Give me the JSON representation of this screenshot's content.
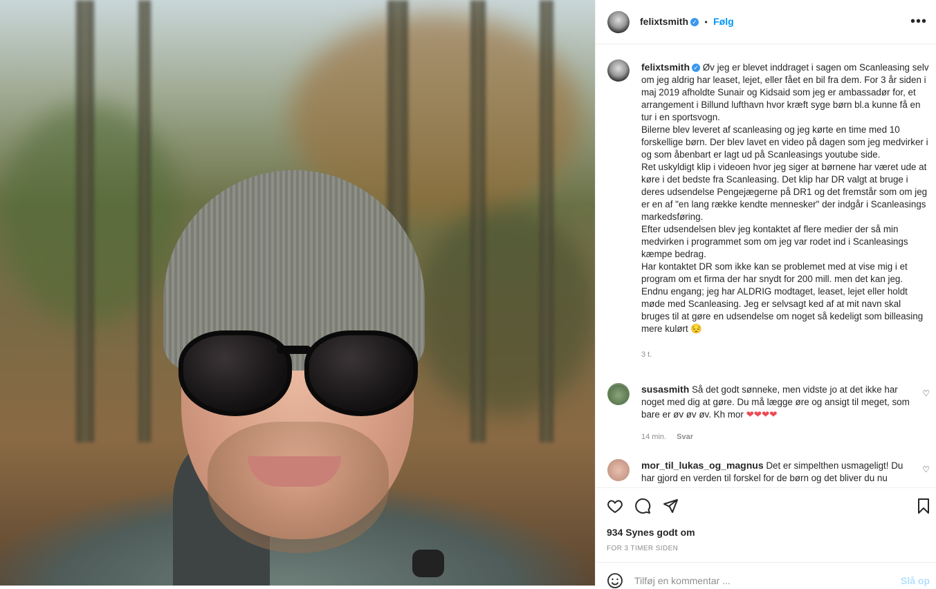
{
  "post": {
    "username": "felixtsmith",
    "follow_label": "Følg",
    "more_label": "•••",
    "dot": "•",
    "caption_paragraphs": [
      "Øv jeg er blevet inddraget i sagen om Scanleasing selv om jeg aldrig har leaset, lejet, eller fået en bil fra dem. For 3 år siden i maj 2019 afholdte Sunair og Kidsaid som jeg er ambassadør for, et arrangement i Billund lufthavn hvor kræft syge børn bl.a kunne få en tur i en sportsvogn.",
      "Bilerne blev leveret af scanleasing og jeg kørte en time med 10 forskellige børn. Der blev lavet en video på dagen som jeg medvirker i og som åbenbart er lagt ud på Scanleasings youtube side.",
      "Ret uskyldigt klip i videoen hvor jeg siger at børnene har været ude at køre i det bedste fra Scanleasing. Det klip har DR valgt at bruge i deres udsendelse Pengejægerne på DR1 og det fremstår som om jeg er en af \"en lang række kendte mennesker\" der indgår i Scanleasings markedsføring.",
      "Efter udsendelsen blev jeg kontaktet af flere medier der så min medvirken i programmet som om jeg var rodet ind i Scanleasings kæmpe bedrag.",
      "Har kontaktet DR som ikke kan se problemet med at vise mig i et program om et firma der har snydt for 200 mill. men det kan jeg. Endnu engang; jeg har ALDRIG modtaget, leaset, lejet eller holdt møde med Scanleasing. Jeg er selvsagt ked af at mit navn skal bruges til at gøre en udsendelse om noget så kedeligt som billeasing mere kulørt 😔"
    ],
    "caption_time": "3 t.",
    "likes": "934 Synes godt om",
    "posted_ago": "FOR 3 TIMER SIDEN",
    "comment_placeholder": "Tilføj en kommentar ...",
    "post_label": "Slå op"
  },
  "comments": [
    {
      "username": "susasmith",
      "text": "Så det godt sønneke, men vidste jo at det ikke har noget med dig at gøre. Du må lægge øre og ansigt til meget, som bare er øv øv øv. Kh mor",
      "emoji": "❤❤❤❤",
      "time": "14 min.",
      "reply_label": "Svar"
    },
    {
      "username": "mor_til_lukas_og_magnus",
      "text": "Det er simpelthen usmageligt! Du har gjord en verden til forskel for de børn og det bliver du nu"
    }
  ]
}
